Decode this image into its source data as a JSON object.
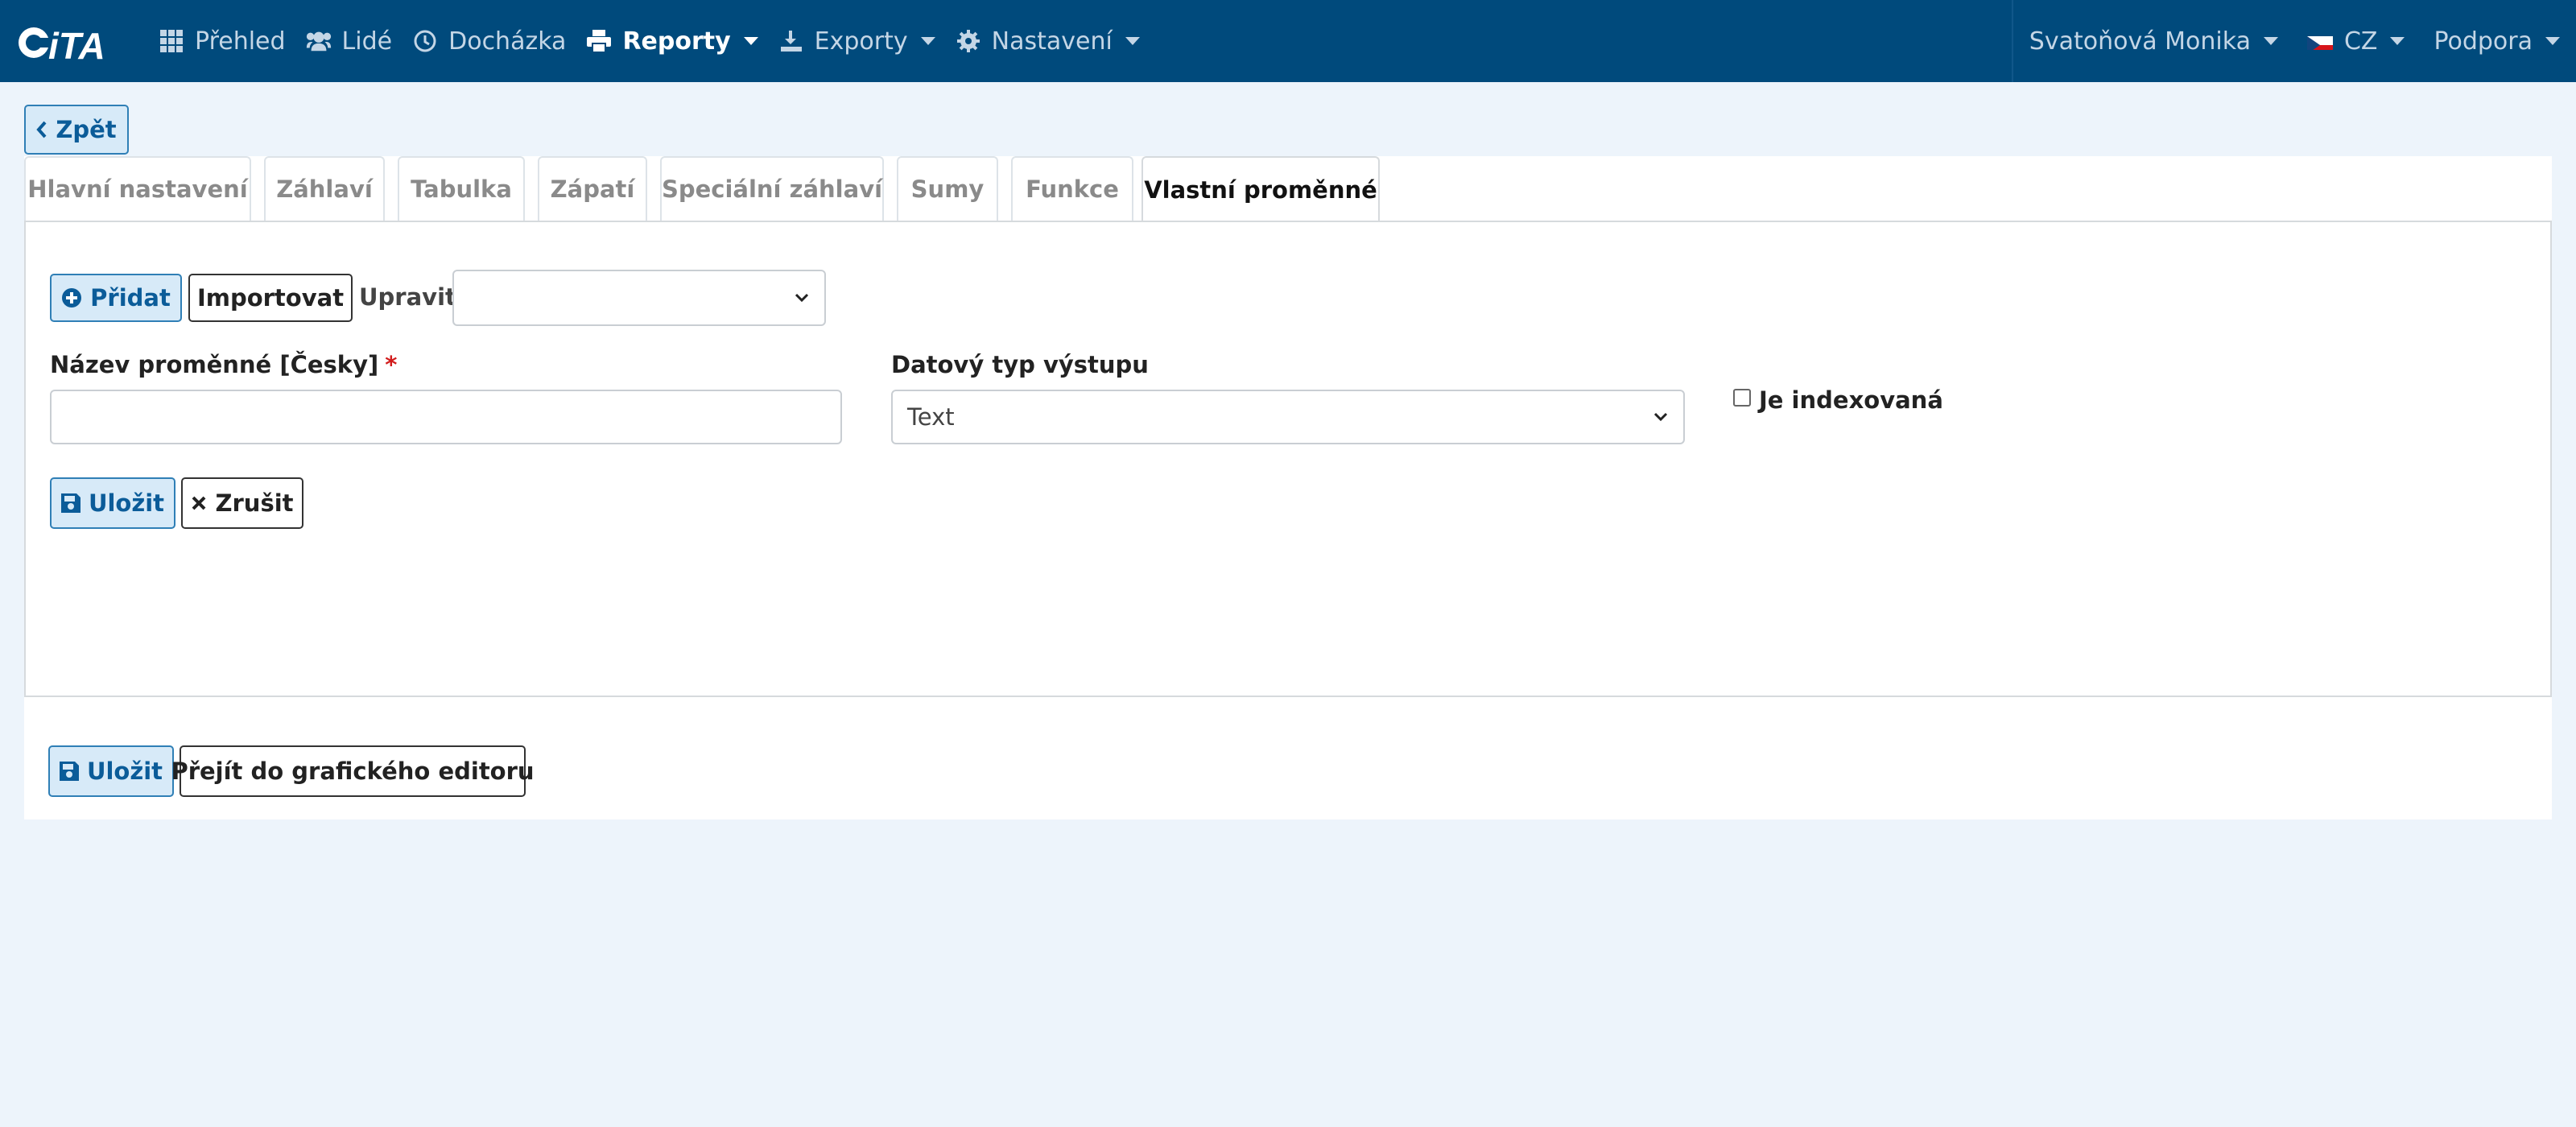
{
  "brand": {
    "logo_text": "iTA"
  },
  "nav": {
    "items": [
      {
        "label": "Přehled",
        "icon": "grid-icon"
      },
      {
        "label": "Lidé",
        "icon": "users-icon"
      },
      {
        "label": "Docházka",
        "icon": "clock-icon"
      },
      {
        "label": "Reporty",
        "icon": "printer-icon",
        "active": true
      },
      {
        "label": "Exporty",
        "icon": "export-icon"
      },
      {
        "label": "Nastavení",
        "icon": "gear-icon"
      }
    ],
    "user": "Svatoňová Monika",
    "language": "CZ",
    "support": "Podpora"
  },
  "back_label": "Zpět",
  "tabs": [
    {
      "label": "Hlavní nastavení"
    },
    {
      "label": "Záhlaví"
    },
    {
      "label": "Tabulka"
    },
    {
      "label": "Zápatí"
    },
    {
      "label": "Speciální záhlaví"
    },
    {
      "label": "Sumy"
    },
    {
      "label": "Funkce"
    },
    {
      "label": "Vlastní proměnné",
      "active": true
    }
  ],
  "form": {
    "add_label": "Přidat",
    "import_label": "Importovat",
    "edit_label": "Upravit",
    "edit_select_value": "",
    "name_label": "Název proměnné [Česky]",
    "required_mark": "*",
    "name_value": "",
    "datatype_label": "Datový typ výstupu",
    "datatype_value": "Text",
    "indexed_label": "Je indexovaná",
    "indexed_checked": false,
    "save_label": "Uložit",
    "cancel_label": "Zrušit"
  },
  "footer": {
    "save_label": "Uložit",
    "graphic_editor_label": "Přejít do grafického editoru"
  },
  "colors": {
    "navbar": "#004a7c",
    "page_background": "#edf4fb",
    "primary_button_bg": "#d7eaf8",
    "primary_button_text": "#0b5c99",
    "required": "#d21c1c"
  }
}
